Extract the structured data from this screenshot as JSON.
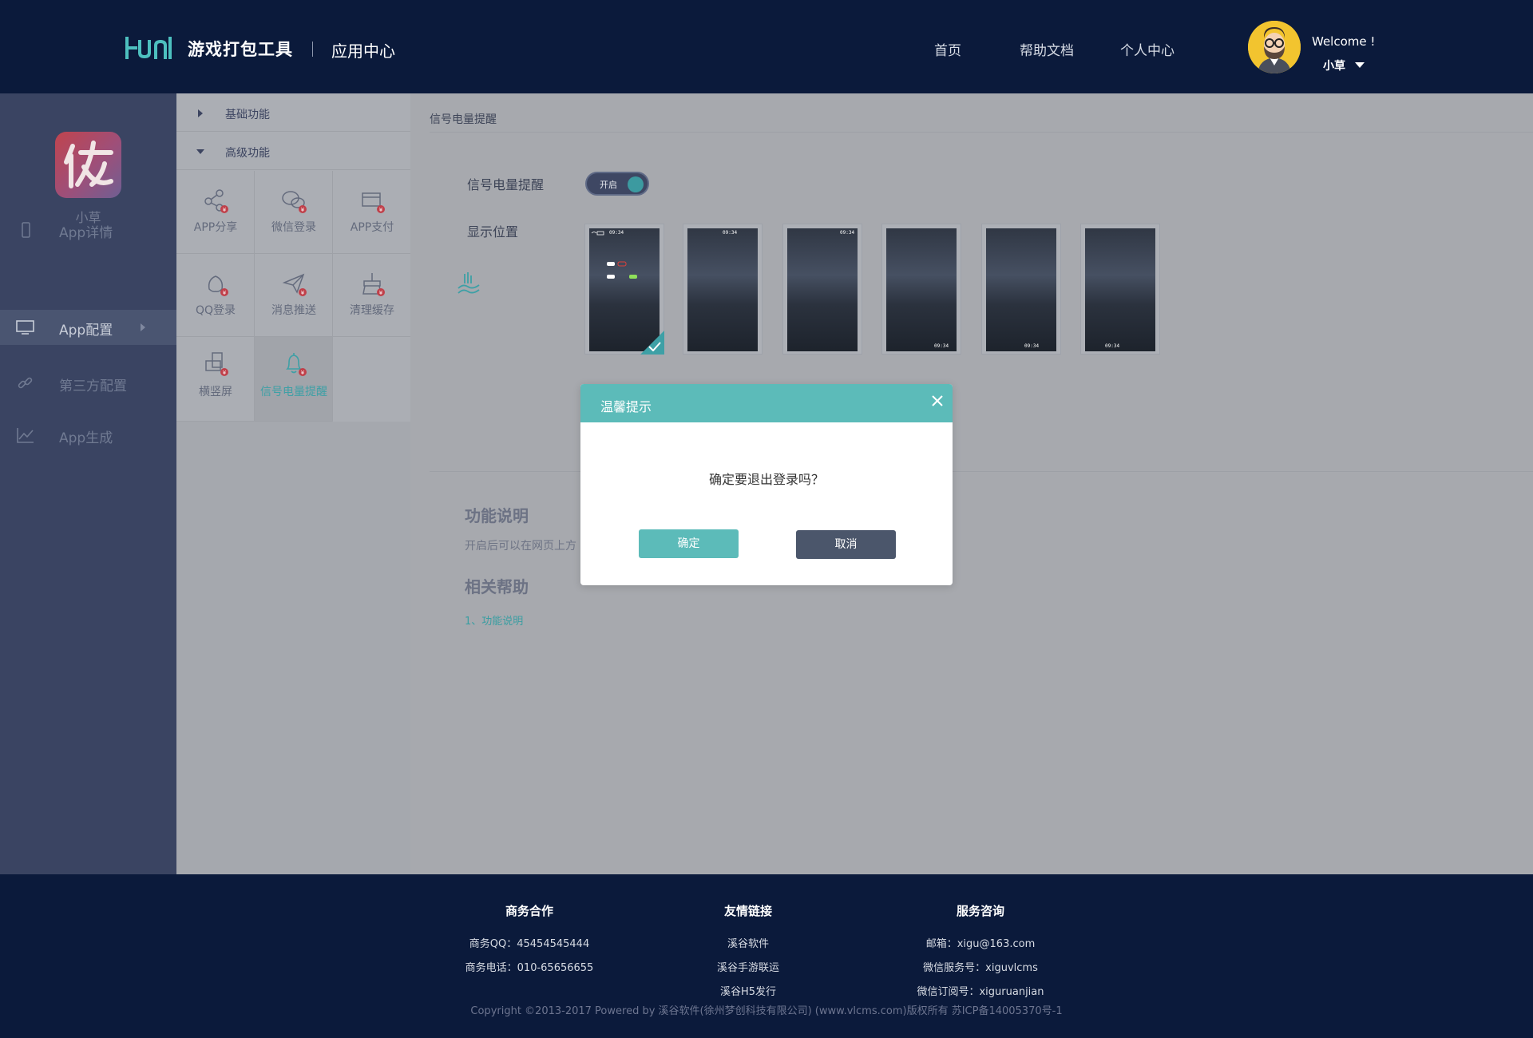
{
  "header": {
    "brand": "游戏打包工具",
    "sub": "应用中心",
    "nav": [
      "首页",
      "帮助文档",
      "个人中心"
    ],
    "welcome": "Welcome !",
    "user": "小草"
  },
  "sidebar": {
    "app_name": "小草",
    "items": [
      {
        "label": "App详情",
        "icon": "phone-icon"
      },
      {
        "label": "App配置",
        "icon": "monitor-icon"
      },
      {
        "label": "第三方配置",
        "icon": "link-icon"
      },
      {
        "label": "App生成",
        "icon": "chart-icon"
      }
    ]
  },
  "panel": {
    "groups": [
      "基础功能",
      "高级功能"
    ],
    "features": [
      "APP分享",
      "微信登录",
      "APP支付",
      "QQ登录",
      "消息推送",
      "清理缓存",
      "横竖屏",
      "信号电量提醒"
    ],
    "badge": "¥"
  },
  "main": {
    "crumb": "信号电量提醒",
    "switch_label": "信号电量提醒",
    "switch_state": "开启",
    "position_label": "显示位置",
    "thumb_time": "09:34",
    "section1_title": "功能说明",
    "section1_text": "开启后可以在网页上方",
    "section2_title": "相关帮助",
    "help_link": "1、功能说明"
  },
  "modal": {
    "title": "温馨提示",
    "message": "确定要退出登录吗？",
    "ok": "确定",
    "cancel": "取消"
  },
  "footer": {
    "col1": {
      "title": "商务合作",
      "lines": [
        "商务QQ：45454545444",
        "商务电话：010-65656655"
      ]
    },
    "col2": {
      "title": "友情链接",
      "lines": [
        "溪谷软件",
        "溪谷手游联运",
        "溪谷H5发行"
      ]
    },
    "col3": {
      "title": "服务咨询",
      "lines": [
        "邮箱：xigu@163.com",
        "微信服务号：xiguvlcms",
        "微信订阅号：xiguruanjian"
      ]
    },
    "copyright": "Copyright ©2013-2017 Powered by 溪谷软件(徐州梦创科技有限公司) (www.vlcms.com)版权所有 苏ICP备14005370号-1"
  },
  "colors": {
    "accent": "#5cbbb9",
    "header_bg": "#0b1a3b",
    "sidebar_bg": "#3a4462"
  }
}
